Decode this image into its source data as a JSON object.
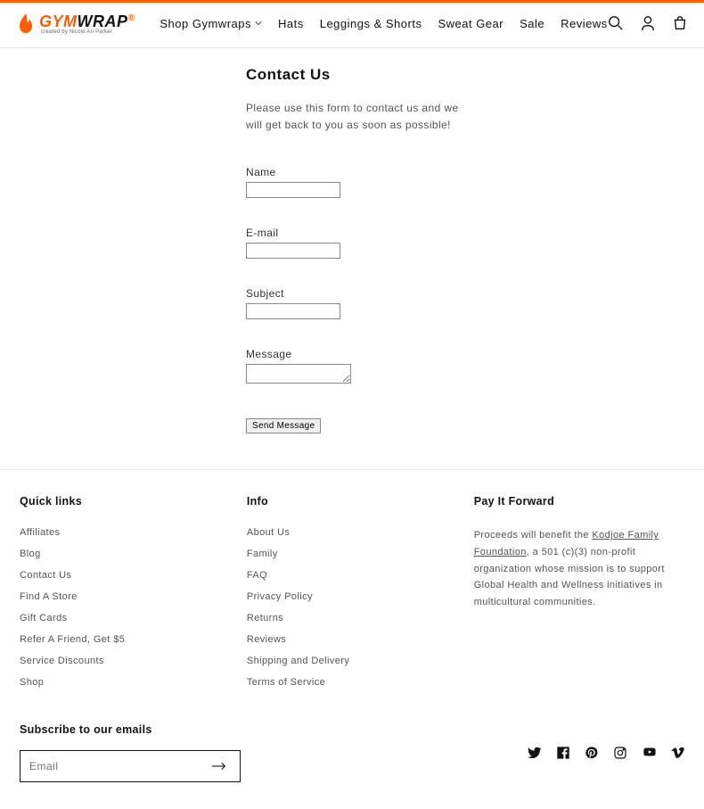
{
  "brand": {
    "name_part1": "GYM",
    "name_part2": "WRAP",
    "tagline": "created by Nicole Ari Parker"
  },
  "nav": {
    "items": [
      {
        "label": "Shop Gymwraps",
        "dropdown": true
      },
      {
        "label": "Hats"
      },
      {
        "label": "Leggings & Shorts"
      },
      {
        "label": "Sweat Gear"
      },
      {
        "label": "Sale"
      },
      {
        "label": "Reviews"
      }
    ]
  },
  "page": {
    "title": "Contact Us",
    "intro": "Please use this form to contact us and we will get back to you as soon as possible!",
    "form": {
      "name_label": "Name",
      "email_label": "E-mail",
      "subject_label": "Subject",
      "message_label": "Message",
      "submit_label": "Send Message"
    }
  },
  "footer": {
    "quick_links": {
      "heading": "Quick links",
      "items": [
        "Affiliates",
        "Blog",
        "Contact Us",
        "Find A Store",
        "Gift Cards",
        "Refer A Friend, Get $5",
        "Service Discounts",
        "Shop"
      ]
    },
    "info": {
      "heading": "Info",
      "items": [
        "About Us",
        "Family",
        "FAQ",
        "Privacy Policy",
        "Returns",
        "Reviews",
        "Shipping and Delivery",
        "Terms of Service"
      ]
    },
    "pay_forward": {
      "heading": "Pay It Forward",
      "text_before": "Proceeds will benefit the ",
      "link_text": "Kodjoe Family Foundation",
      "text_after": ", a 501 (c)(3) non-profit organization whose mission is to support Global Health and Wellness initiatives in multicultural communities."
    },
    "subscribe": {
      "heading": "Subscribe to our emails",
      "placeholder": "Email"
    }
  }
}
